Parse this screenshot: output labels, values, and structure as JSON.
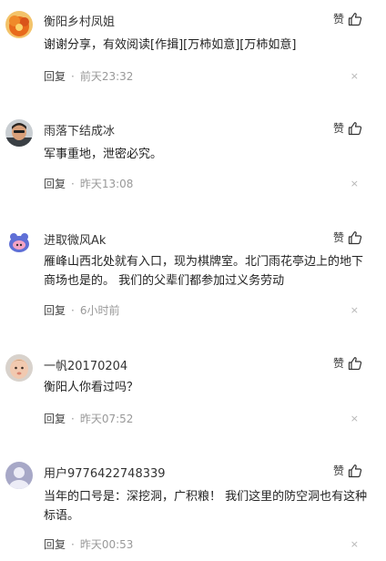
{
  "comments": [
    {
      "username": "衡阳乡村凤姐",
      "like_label": "赞",
      "content": "谢谢分享，有效阅读[作揖][万柿如意][万柿如意]",
      "reply_label": "回复",
      "separator": "·",
      "time": "前天23:32",
      "close_glyph": "×",
      "avatar_icon": "orange-flower-avatar"
    },
    {
      "username": "雨落下结成冰",
      "like_label": "赞",
      "content": "军事重地，泄密必究。",
      "reply_label": "回复",
      "separator": "·",
      "time": "昨天13:08",
      "close_glyph": "×",
      "avatar_icon": "man-portrait-avatar"
    },
    {
      "username": "进取微风Ak",
      "like_label": "赞",
      "content": "雁峰山西北处就有入口，现为棋牌室。北门雨花亭边上的地下商场也是的。 我们的父辈们都参加过义务劳动",
      "reply_label": "回复",
      "separator": "·",
      "time": "6小时前",
      "close_glyph": "×",
      "avatar_icon": "cartoon-pig-avatar"
    },
    {
      "username": "一帆20170204",
      "like_label": "赞",
      "content": "衡阳人你看过吗？",
      "reply_label": "回复",
      "separator": "·",
      "time": "昨天07:52",
      "close_glyph": "×",
      "avatar_icon": "baby-face-avatar"
    },
    {
      "username": "用户9776422748339",
      "like_label": "赞",
      "content": "当年的口号是：深挖洞，广积粮！ 我们这里的防空洞也有这种标语。",
      "reply_label": "回复",
      "separator": "·",
      "time": "昨天00:53",
      "close_glyph": "×",
      "avatar_icon": "default-user-avatar"
    }
  ],
  "colors": {
    "text": "#222222",
    "meta": "#999999",
    "close": "#b5b5b5"
  }
}
